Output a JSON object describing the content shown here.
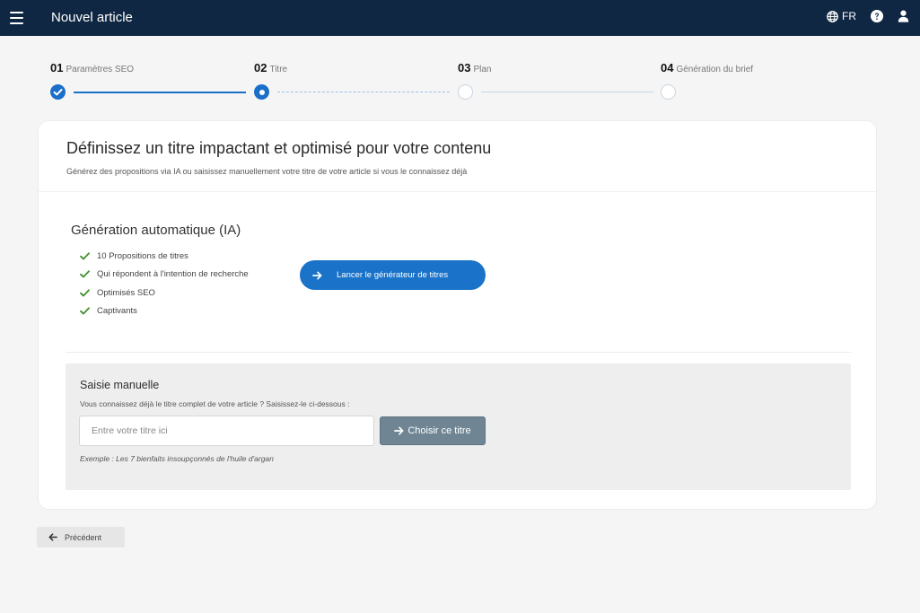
{
  "topbar": {
    "title": "Nouvel article",
    "language": "FR",
    "icons": [
      "menu-icon",
      "globe-icon",
      "help-icon",
      "user-icon"
    ]
  },
  "stepper": {
    "steps": [
      {
        "num": "01",
        "label": "Paramètres SEO",
        "state": "done"
      },
      {
        "num": "02",
        "label": "Titre",
        "state": "current"
      },
      {
        "num": "03",
        "label": "Plan",
        "state": "todo"
      },
      {
        "num": "04",
        "label": "Génération du brief",
        "state": "todo"
      }
    ]
  },
  "card": {
    "title": "Définissez un titre impactant et optimisé pour votre contenu",
    "subtitle": "Générez des propositions via IA ou saisissez manuellement votre titre de votre article si vous le connaissez déjà"
  },
  "ai": {
    "title": "Génération automatique (IA)",
    "features": [
      "10 Propositions de titres",
      "Qui répondent à l'intention de recherche",
      "Optimisés SEO",
      "Captivants"
    ],
    "button_label": "Lancer le générateur de titres"
  },
  "manual": {
    "title": "Saisie manuelle",
    "subtitle": "Vous connaissez déjà le titre complet de votre article ? Saisissez-le ci-dessous :",
    "input_value": "",
    "input_placeholder": "Entre votre titre ici",
    "button_label": "Choisir ce titre",
    "example": "Exemple : Les 7 bienfaits insoupçonnés de l'huile d'argan"
  },
  "footer": {
    "prev_label": "Précédent"
  },
  "colors": {
    "topbar": "#0f2742",
    "accent": "#1a73c9",
    "check": "#3f8f2c",
    "choose_button": "#6f8593"
  }
}
